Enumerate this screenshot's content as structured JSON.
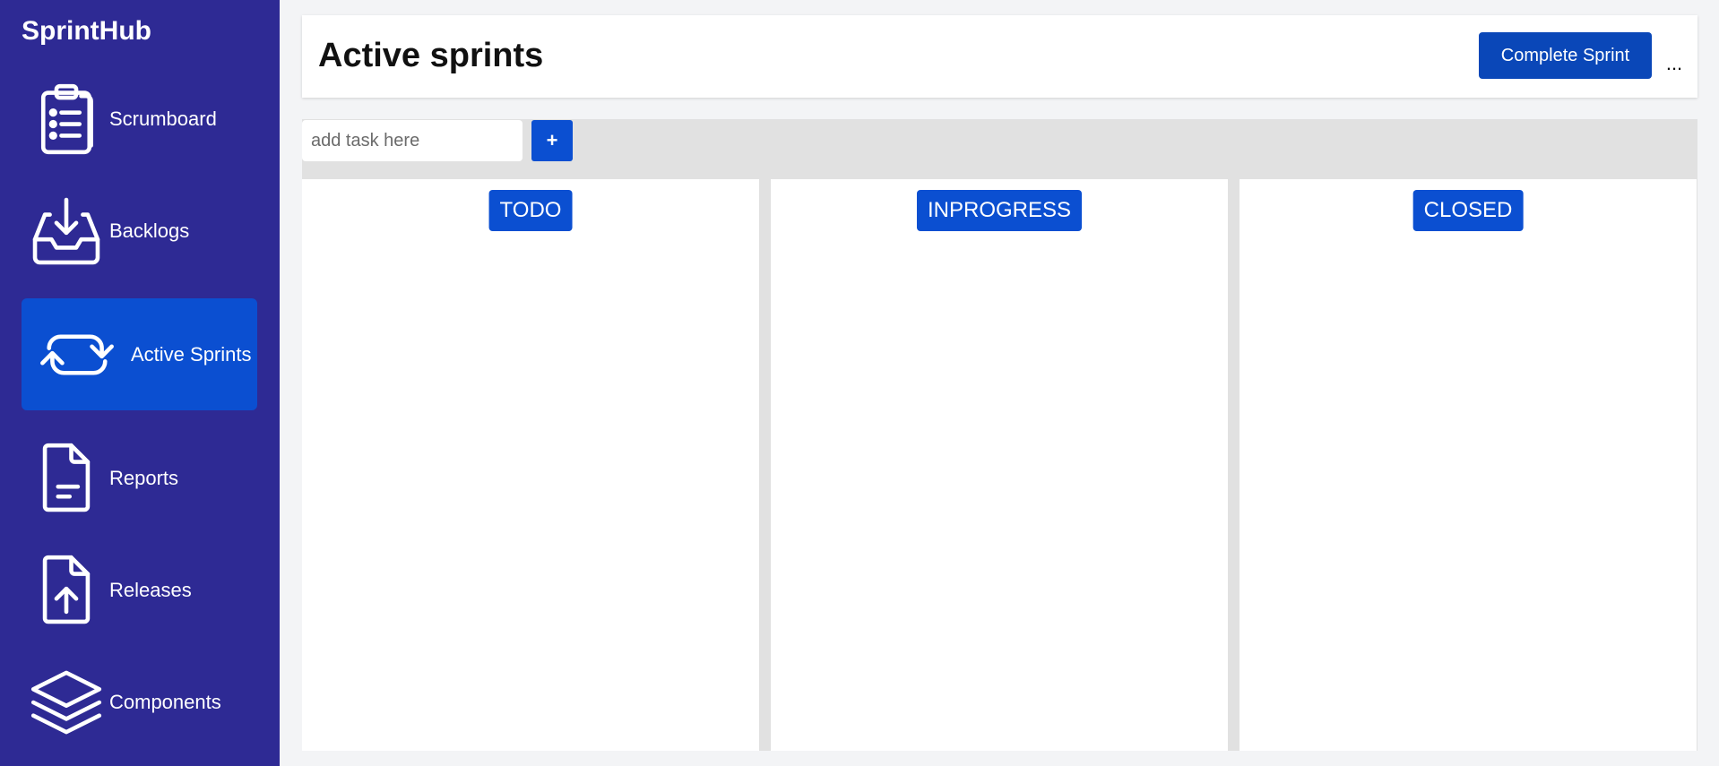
{
  "app": {
    "brand": "SprintHub"
  },
  "sidebar": {
    "items": [
      {
        "label": "Scrumboard",
        "icon": "clipboard-list-icon"
      },
      {
        "label": "Backlogs",
        "icon": "inbox-download-icon"
      },
      {
        "label": "Active Sprints",
        "icon": "refresh-icon",
        "active": true
      },
      {
        "label": "Reports",
        "icon": "document-text-icon"
      },
      {
        "label": "Releases",
        "icon": "document-upload-icon"
      },
      {
        "label": "Components",
        "icon": "stack-layers-icon"
      }
    ]
  },
  "header": {
    "title": "Active sprints",
    "complete_label": "Complete Sprint",
    "more_label": "..."
  },
  "board": {
    "task_placeholder": "add task here",
    "add_label": "+",
    "columns": [
      {
        "label": "TODO"
      },
      {
        "label": "INPROGRESS"
      },
      {
        "label": "CLOSED"
      }
    ]
  },
  "colors": {
    "sidebar_bg": "#2e2a94",
    "active_bg": "#0b4fd1",
    "primary_button": "#0a47b8",
    "board_bg": "#e1e1e1"
  }
}
